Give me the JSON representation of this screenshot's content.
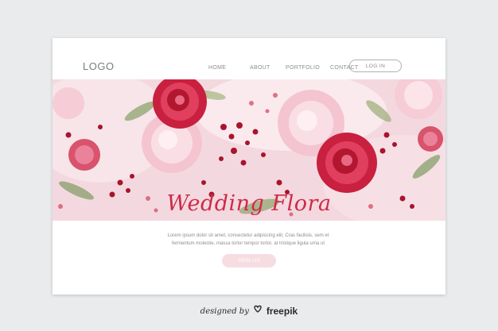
{
  "header": {
    "logo": "LOGO",
    "nav": [
      {
        "label": "HOME"
      },
      {
        "label": "ABOUT"
      },
      {
        "label": "PORTFOLIO"
      },
      {
        "label": "CONTACT"
      }
    ],
    "login_label": "LOG IN"
  },
  "hero": {
    "image": "watercolor-floral-banner-icon",
    "colors": {
      "background": "#f3d9df",
      "rose": "#d12c4b",
      "peony": "#f4c5d0",
      "leaf": "#8da36c"
    }
  },
  "main": {
    "title": "Wedding Flora",
    "description_lines": [
      "Lorem ipsum dolor sit amet, consectetur adipiscing elit. Cras facilisis, sem et",
      "fermentum molestie, massa tortor tempor tortor, at tristique ligula urna ut"
    ],
    "cta_label": "JOIN US",
    "colors": {
      "accent": "#cf2a48",
      "button": "#f6dde2"
    }
  },
  "credit": {
    "text": "designed by",
    "brand": "freepik",
    "icon": "freepik-logo-icon"
  }
}
